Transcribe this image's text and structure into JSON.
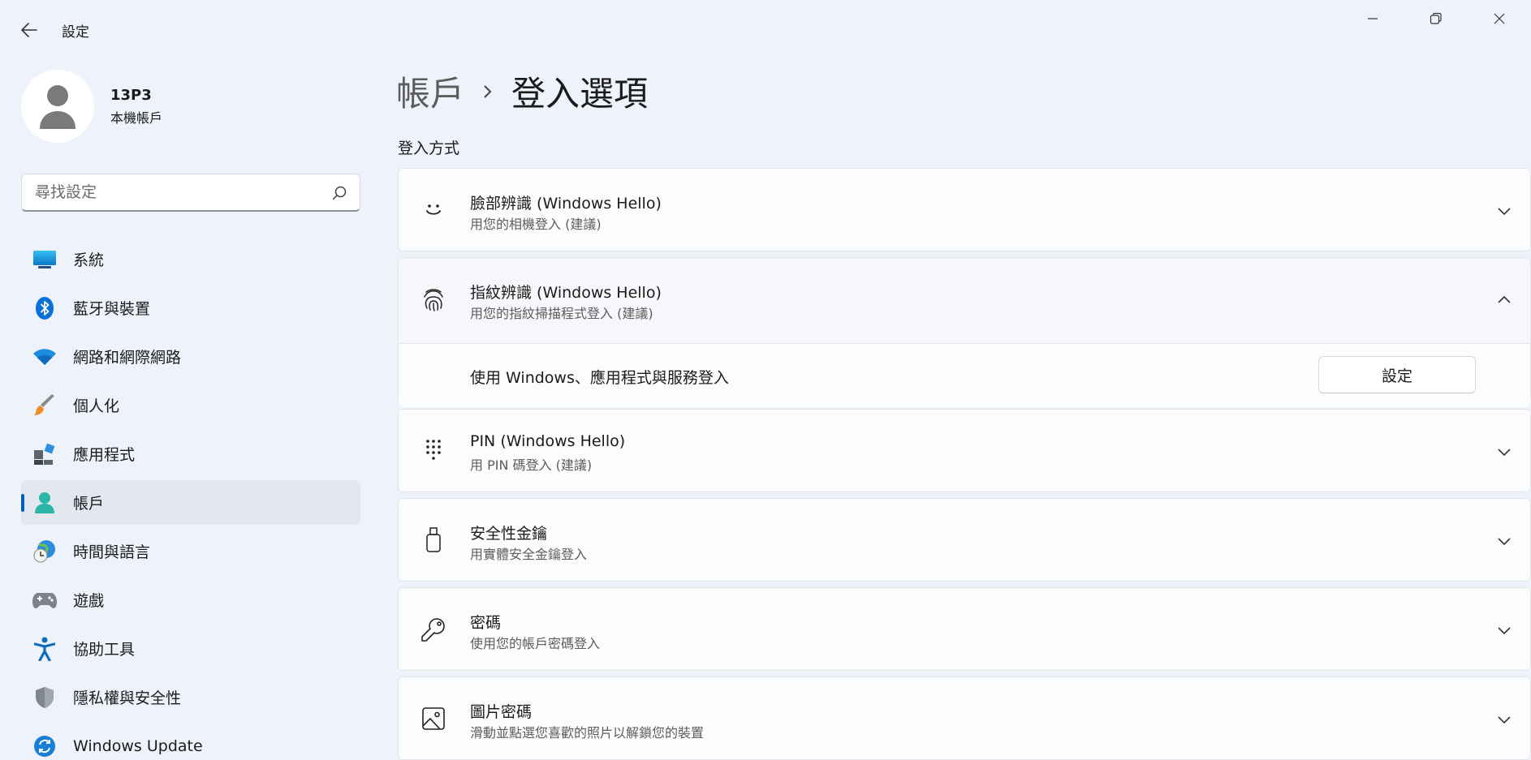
{
  "app": {
    "title": "設定"
  },
  "window_controls": [
    "minimize",
    "restore",
    "close"
  ],
  "profile": {
    "name": "13P3",
    "account_type": "本機帳戶"
  },
  "search": {
    "placeholder": "尋找設定",
    "value": ""
  },
  "sidebar": {
    "items": [
      {
        "label": "系統",
        "icon": "system-icon",
        "active": false
      },
      {
        "label": "藍牙與裝置",
        "icon": "bluetooth-icon",
        "active": false
      },
      {
        "label": "網路和網際網路",
        "icon": "wifi-icon",
        "active": false
      },
      {
        "label": "個人化",
        "icon": "paintbrush-icon",
        "active": false
      },
      {
        "label": "應用程式",
        "icon": "apps-icon",
        "active": false
      },
      {
        "label": "帳戶",
        "icon": "account-icon",
        "active": true
      },
      {
        "label": "時間與語言",
        "icon": "time-language-icon",
        "active": false
      },
      {
        "label": "遊戲",
        "icon": "gamepad-icon",
        "active": false
      },
      {
        "label": "協助工具",
        "icon": "accessibility-icon",
        "active": false
      },
      {
        "label": "隱私權與安全性",
        "icon": "shield-icon",
        "active": false
      },
      {
        "label": "Windows Update",
        "icon": "windows-update-icon",
        "active": false
      }
    ]
  },
  "breadcrumb": {
    "parent": "帳戶",
    "current": "登入選項"
  },
  "section": {
    "title": "登入方式"
  },
  "options": [
    {
      "title": "臉部辨識 (Windows Hello)",
      "subtitle": "用您的相機登入 (建議)",
      "icon": "face-icon",
      "expanded": false
    },
    {
      "title": "指紋辨識 (Windows Hello)",
      "subtitle": "用您的指紋掃描程式登入 (建議)",
      "icon": "fingerprint-icon",
      "expanded": true,
      "detail_label": "使用 Windows、應用程式與服務登入",
      "button_label": "設定"
    },
    {
      "title": "PIN (Windows Hello)",
      "subtitle": "用 PIN 碼登入 (建議)",
      "icon": "pin-keypad-icon",
      "expanded": false
    },
    {
      "title": "安全性金鑰",
      "subtitle": "用實體安全金鑰登入",
      "icon": "usb-key-icon",
      "expanded": false
    },
    {
      "title": "密碼",
      "subtitle": "使用您的帳戶密碼登入",
      "icon": "key-icon",
      "expanded": false
    },
    {
      "title": "圖片密碼",
      "subtitle": "滑動並點選您喜歡的照片以解鎖您的裝置",
      "icon": "picture-icon",
      "expanded": false
    }
  ],
  "colors": {
    "background": "#eef2fa",
    "card": "#fbfcfe",
    "accent": "#005fb8"
  }
}
